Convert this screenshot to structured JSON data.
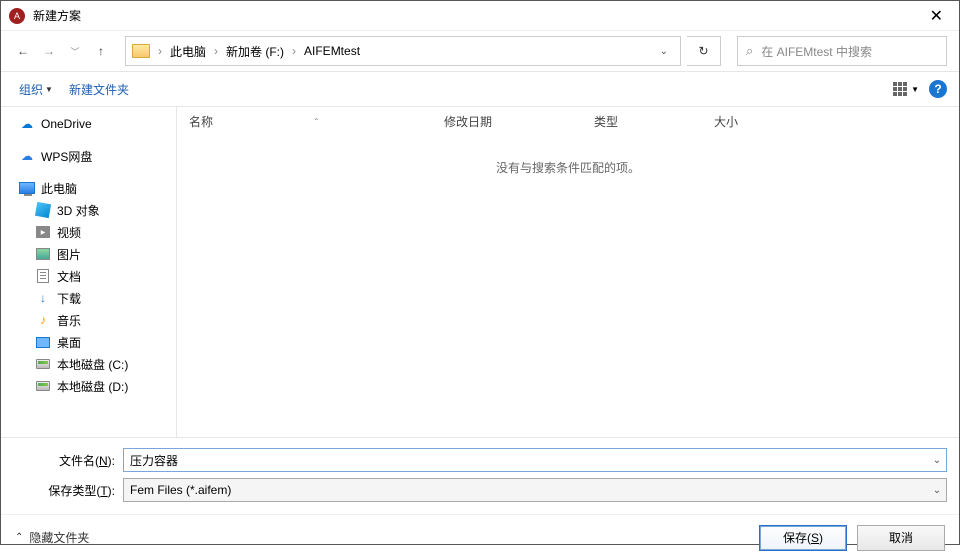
{
  "title": "新建方案",
  "nav": {
    "crumbs": [
      "此电脑",
      "新加卷 (F:)",
      "AIFEMtest"
    ],
    "search_placeholder": "在 AIFEMtest 中搜索"
  },
  "toolbar": {
    "organize": "组织",
    "new_folder": "新建文件夹"
  },
  "sidebar": {
    "items": [
      {
        "label": "OneDrive",
        "icon": "cloud",
        "indent": 0
      },
      {
        "label": "WPS网盘",
        "icon": "wps",
        "indent": 0
      },
      {
        "label": "此电脑",
        "icon": "pc",
        "indent": 0
      },
      {
        "label": "3D 对象",
        "icon": "3d",
        "indent": 1
      },
      {
        "label": "视频",
        "icon": "video",
        "indent": 1
      },
      {
        "label": "图片",
        "icon": "img",
        "indent": 1
      },
      {
        "label": "文档",
        "icon": "doc",
        "indent": 1
      },
      {
        "label": "下载",
        "icon": "dl",
        "indent": 1
      },
      {
        "label": "音乐",
        "icon": "music",
        "indent": 1
      },
      {
        "label": "桌面",
        "icon": "desk",
        "indent": 1
      },
      {
        "label": "本地磁盘 (C:)",
        "icon": "disk",
        "indent": 1
      },
      {
        "label": "本地磁盘 (D:)",
        "icon": "disk",
        "indent": 1
      }
    ]
  },
  "columns": {
    "name": "名称",
    "date": "修改日期",
    "type": "类型",
    "size": "大小"
  },
  "empty_text": "没有与搜索条件匹配的项。",
  "fields": {
    "filename_label_pre": "文件名(",
    "filename_label_u": "N",
    "filename_label_post": "):",
    "filename_value": "压力容器",
    "filetype_label_pre": "保存类型(",
    "filetype_label_u": "T",
    "filetype_label_post": "):",
    "filetype_value": "Fem Files (*.aifem)"
  },
  "footer": {
    "hide_folders": "隐藏文件夹",
    "save_pre": "保存(",
    "save_u": "S",
    "save_post": ")",
    "cancel": "取消"
  }
}
